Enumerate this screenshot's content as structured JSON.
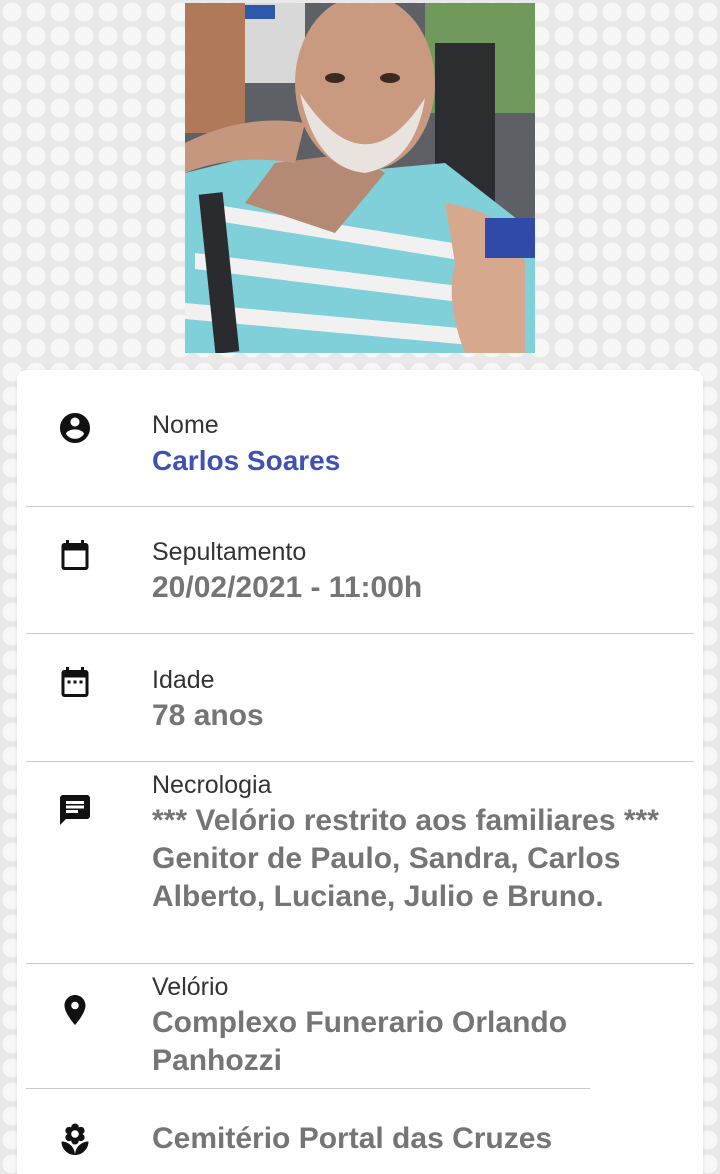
{
  "photo": {
    "alt": ""
  },
  "fields": [
    {
      "label": "Nome",
      "value": "Carlos Soares",
      "icon": "account-circle-icon"
    },
    {
      "label": "Sepultamento",
      "value": "20/02/2021 - 11:00h",
      "icon": "calendar-icon"
    },
    {
      "label": "Idade",
      "value": "78 anos",
      "icon": "calendar-dots-icon"
    },
    {
      "label": "Necrologia",
      "value_line1": "*** Velório restrito aos familiares ***",
      "value_line2": "Genitor de Paulo, Sandra, Carlos Alberto, Luciane, Julio e Bruno.",
      "icon": "message-icon"
    },
    {
      "label": "Velório",
      "value": "Complexo Funerario Orlando Panhozzi",
      "icon": "location-pin-icon"
    },
    {
      "label": "",
      "value": "Cemitério Portal das Cruzes",
      "icon": "flower-icon"
    }
  ],
  "colors": {
    "name_accent": "#3f51b5",
    "value_gray": "#757575",
    "label_dark": "#333333"
  }
}
